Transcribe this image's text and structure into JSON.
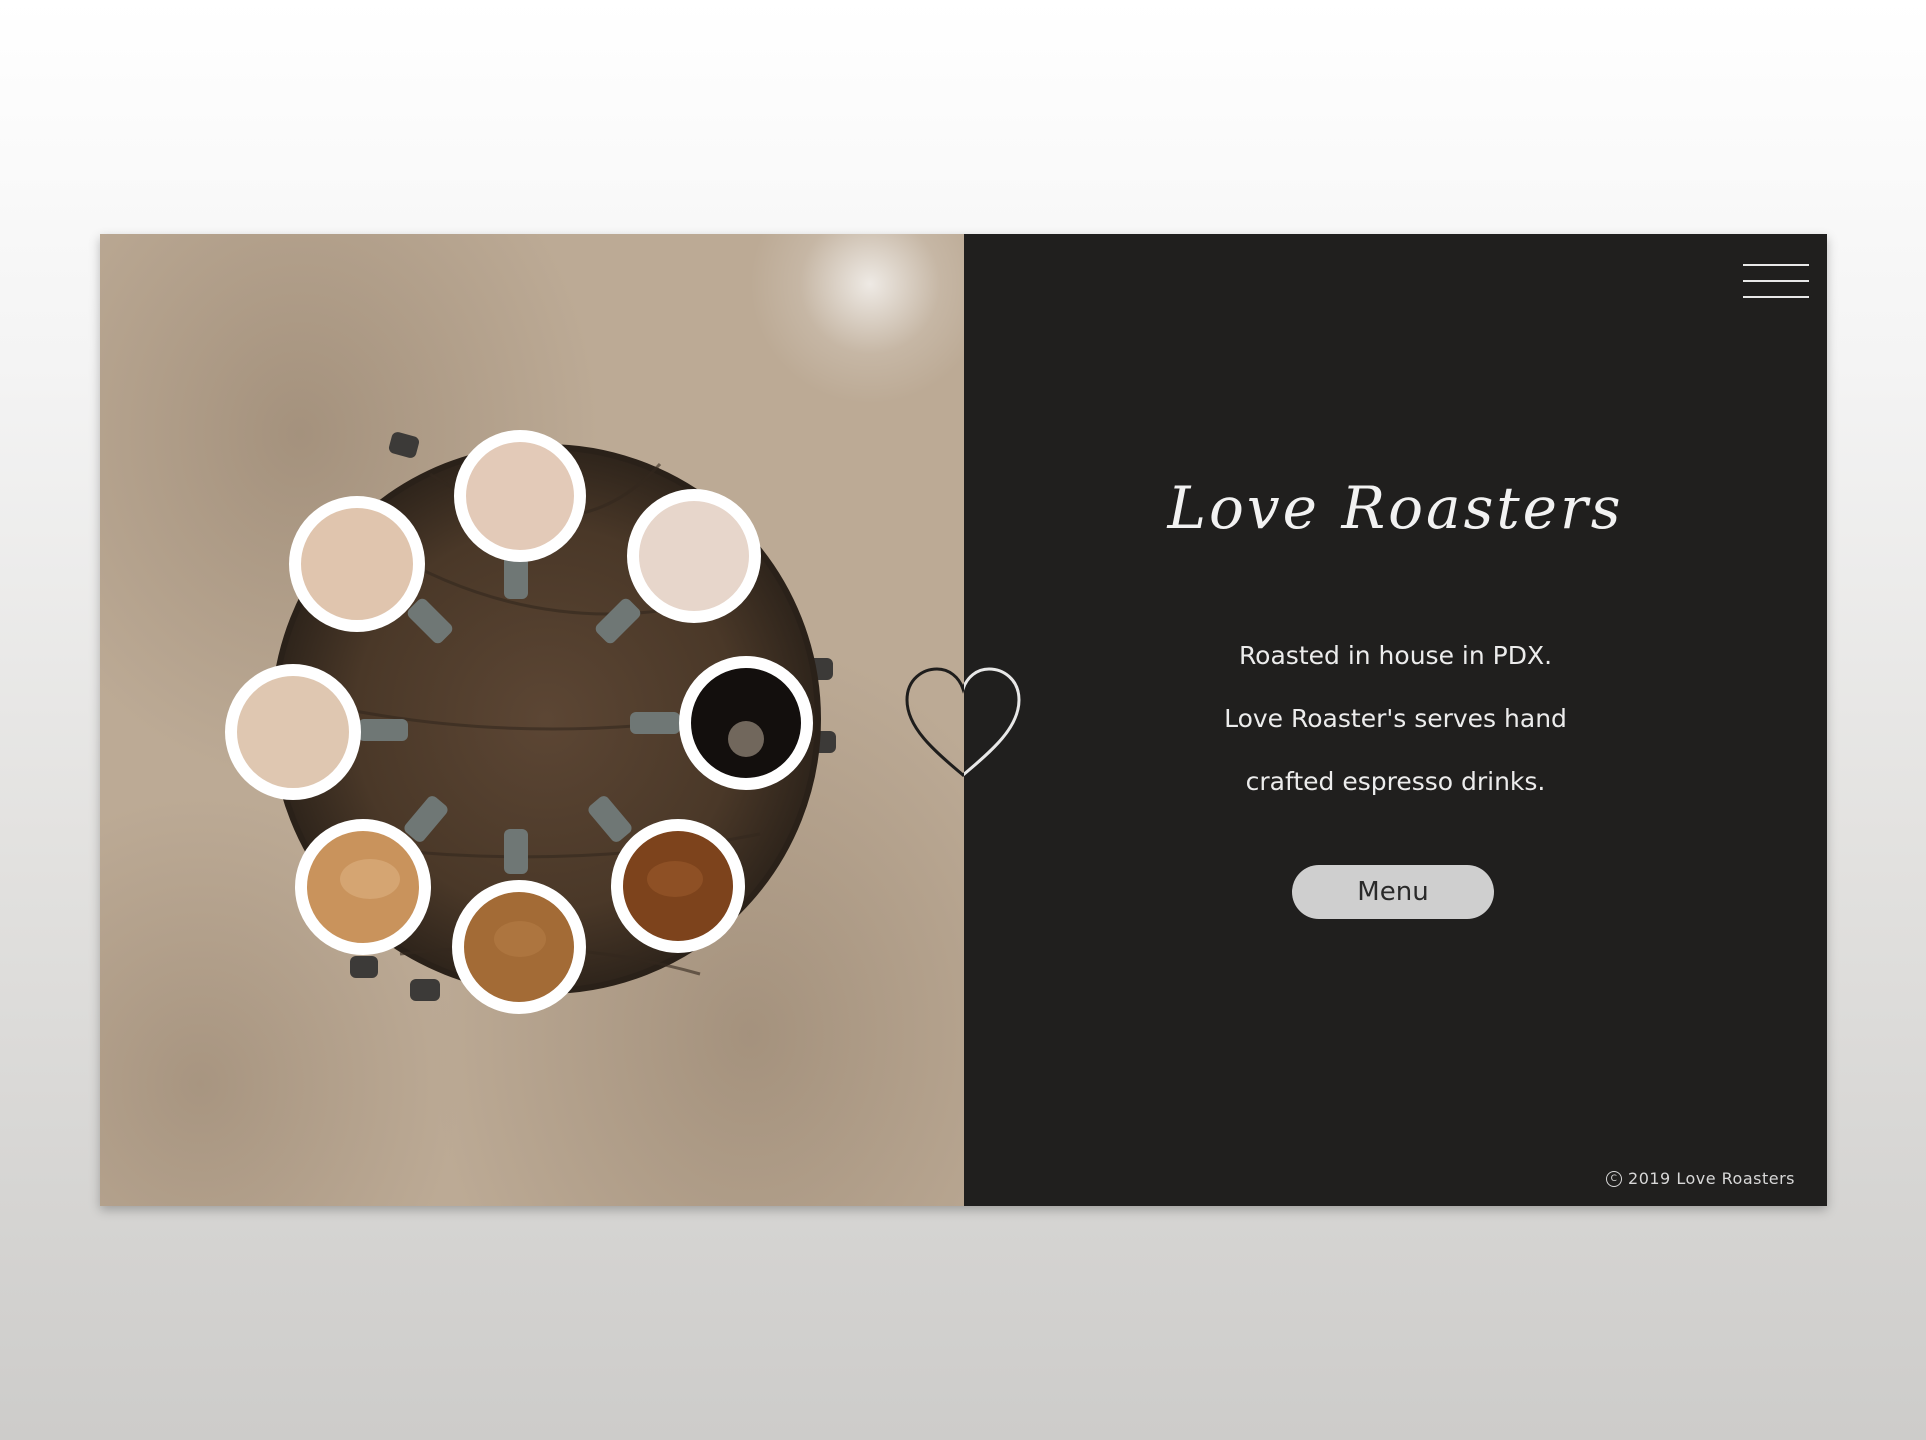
{
  "brand": {
    "title": "Love Roasters"
  },
  "tagline": [
    "Roasted in house in PDX.",
    "Love Roaster's serves hand",
    "crafted espresso drinks."
  ],
  "menu_button": {
    "label": "Menu"
  },
  "footer": {
    "copyright_symbol": "C",
    "text": "2019 Love Roasters"
  },
  "icons": {
    "hamburger": "hamburger-menu-icon",
    "heart": "heart-outline-icon"
  },
  "colors": {
    "panel_bg": "#201f1e",
    "button_bg": "#cfcfcf",
    "text": "#ececec"
  }
}
